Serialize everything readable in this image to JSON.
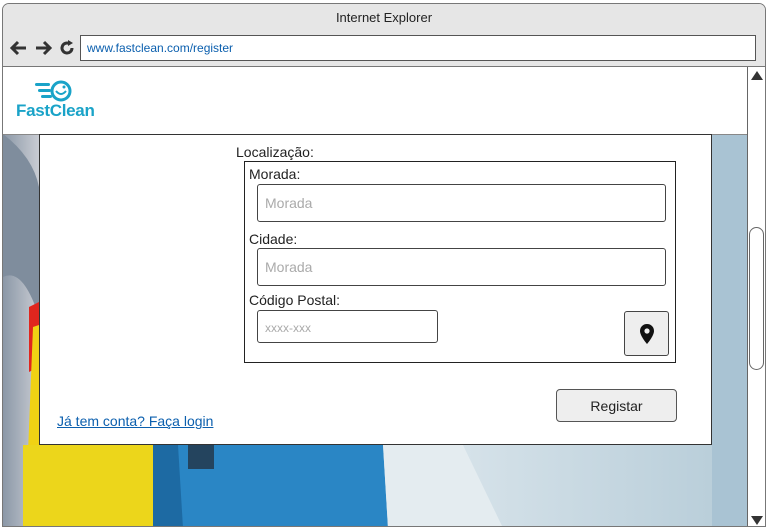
{
  "browser": {
    "title": "Internet Explorer",
    "url": "www.fastclean.com/register"
  },
  "site": {
    "logo_text": "FastClean",
    "brand_color": "#1aa3c8"
  },
  "form": {
    "location_label": "Localização:",
    "address_label": "Morada:",
    "address_placeholder": "Morada",
    "city_label": "Cidade:",
    "city_placeholder": "Morada",
    "postal_label": "Código Postal:",
    "postal_placeholder": "xxxx-xxx",
    "map_button_icon": "map-pin-icon",
    "submit_label": "Registar",
    "login_link": "Já tem conta? Faça login"
  }
}
